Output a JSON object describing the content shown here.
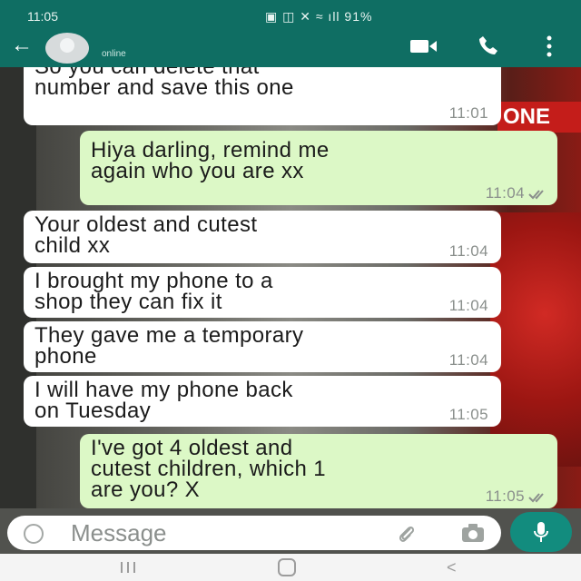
{
  "status_bar": {
    "time": "11:05",
    "icons": "▣ ◫ ✕ ≈ ıll 91%"
  },
  "header": {
    "presence": "online"
  },
  "messages": [
    {
      "direction": "incoming",
      "lines": [
        "So you can delete that",
        "number and save this one"
      ],
      "time": "11:01"
    },
    {
      "direction": "outgoing",
      "lines": [
        "Hiya darling, remind me",
        "again who you are xx"
      ],
      "time": "11:04"
    },
    {
      "direction": "incoming",
      "lines": [
        "Your oldest and cutest",
        "child xx"
      ],
      "time": "11:04"
    },
    {
      "direction": "incoming",
      "lines": [
        "I brought my phone to a",
        "shop they can fix it"
      ],
      "time": "11:04"
    },
    {
      "direction": "incoming",
      "lines": [
        "They gave me a temporary",
        "phone"
      ],
      "time": "11:04"
    },
    {
      "direction": "incoming",
      "lines": [
        "I will have my phone back",
        "on Tuesday"
      ],
      "time": "11:05"
    },
    {
      "direction": "outgoing",
      "lines": [
        "I've got 4 oldest and",
        "cutest children, which 1",
        "are you? X"
      ],
      "time": "11:05"
    }
  ],
  "wallpaper": {
    "sign_text": "ONE"
  },
  "composer": {
    "placeholder": "Message"
  },
  "colors": {
    "header": "#0f6e63",
    "outgoing_bubble": "#dcf8c6",
    "incoming_bubble": "#ffffff",
    "mic_button": "#128c7e"
  },
  "icons": [
    "back-arrow-icon",
    "avatar",
    "video-call-icon",
    "phone-call-icon",
    "more-options-icon",
    "emoji-icon",
    "attach-icon",
    "camera-icon",
    "mic-icon",
    "double-check-icon",
    "nav-recents-icon",
    "nav-home-icon",
    "nav-back-icon"
  ]
}
